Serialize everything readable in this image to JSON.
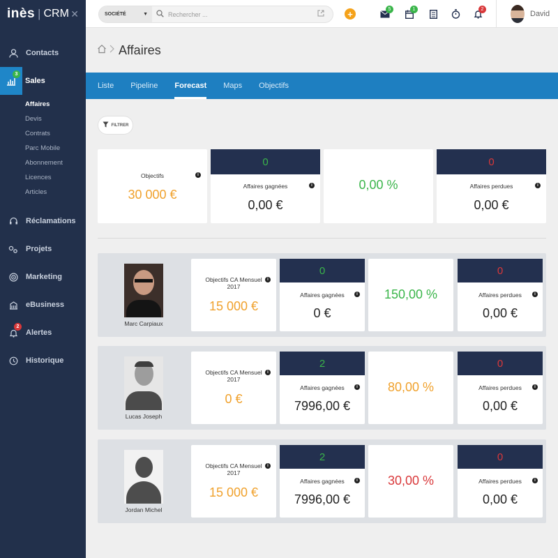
{
  "app": {
    "brand": "inès",
    "product": "CRM"
  },
  "sidebar": {
    "items": [
      {
        "label": "Contacts"
      },
      {
        "label": "Sales",
        "badge": "3"
      },
      {
        "label": "Réclamations"
      },
      {
        "label": "Projets"
      },
      {
        "label": "Marketing"
      },
      {
        "label": "eBusiness"
      },
      {
        "label": "Alertes",
        "badge": "2"
      },
      {
        "label": "Historique"
      }
    ],
    "subitems": [
      "Affaires",
      "Devis",
      "Contrats",
      "Parc Mobile",
      "Abonnement",
      "Licences",
      "Articles"
    ]
  },
  "topbar": {
    "search_scope": "SOCIÉTÉ",
    "search_placeholder": "Rechercher ...",
    "badges": {
      "mail": "5",
      "calendar": "1",
      "notifications": "2"
    },
    "user_name": "David"
  },
  "page": {
    "title": "Affaires"
  },
  "tabs": [
    "Liste",
    "Pipeline",
    "Forecast",
    "Maps",
    "Objectifs"
  ],
  "filter_label": "FILTRER",
  "summary": {
    "objectifs_label": "Objectifs",
    "objectifs_value": "30 000 €",
    "won_count": "0",
    "won_label": "Affaires gagnées",
    "won_value": "0,00 €",
    "rate": "0,00 %",
    "lost_count": "0",
    "lost_label": "Affaires perdues",
    "lost_value": "0,00 €"
  },
  "people": [
    {
      "name": "Marc Carpiaux",
      "obj_label": "Objectifs CA Mensuel 2017",
      "obj_value": "15 000 €",
      "won_count": "0",
      "won_label": "Affaires gagnées",
      "won_value": "0 €",
      "rate": "150,00 %",
      "rate_color": "green",
      "lost_count": "0",
      "lost_label": "Affaires perdues",
      "lost_value": "0,00 €"
    },
    {
      "name": "Lucas Joseph",
      "obj_label": "Objectifs CA Mensuel 2017",
      "obj_value": "0 €",
      "won_count": "2",
      "won_label": "Affaires gagnées",
      "won_value": "7996,00 €",
      "rate": "80,00 %",
      "rate_color": "orange",
      "lost_count": "0",
      "lost_label": "Affaires perdues",
      "lost_value": "0,00 €"
    },
    {
      "name": "Jordan Michel",
      "obj_label": "Objectifs CA Mensuel 2017",
      "obj_value": "15 000 €",
      "won_count": "2",
      "won_label": "Affaires gagnées",
      "won_value": "7996,00 €",
      "rate": "30,00 %",
      "rate_color": "red",
      "lost_count": "0",
      "lost_label": "Affaires perdues",
      "lost_value": "0,00 €"
    }
  ],
  "colors": {
    "sidebar": "#22304b",
    "accent": "#1e7fc1",
    "navy_header": "#23304f",
    "orange": "#f0a12c",
    "green": "#3ab54a",
    "red": "#d9383a"
  }
}
